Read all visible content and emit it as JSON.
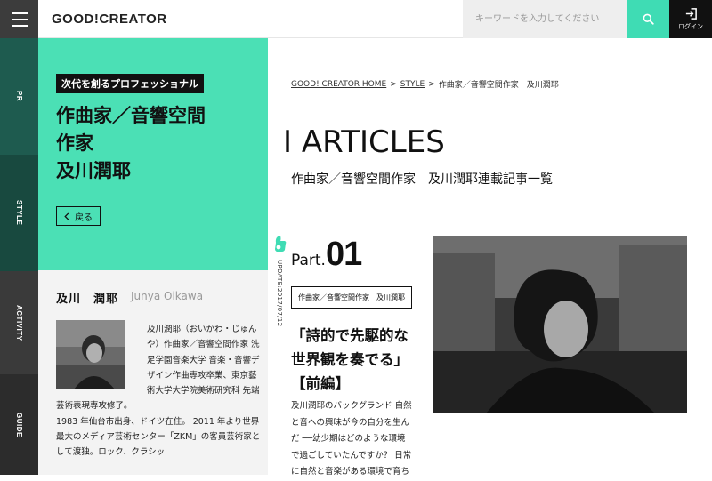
{
  "header": {
    "logo": "GOOD!CREATOR",
    "search_placeholder": "キーワードを入力してください",
    "login_label": "ログイン"
  },
  "sidenav": {
    "items": [
      {
        "label": "PR"
      },
      {
        "label": "STYLE"
      },
      {
        "label": "ACTIVITY"
      },
      {
        "label": "GUIDE"
      }
    ]
  },
  "panel": {
    "tag": "次代を創るプロフェッショナル",
    "headline_lines": [
      "作曲家／音響空間",
      "作家",
      "及川潤耶"
    ],
    "back_label": "戻る"
  },
  "profile": {
    "name": "及川　潤耶",
    "roman": "Junya Oikawa",
    "bio_1": "及川潤耶（おいかわ・じゅんや）作曲家／音響空間作家 洗足学園音楽大学 音楽・音響デザイン作曲専攻卒業、東京藝術大学大学院美術研究科 先端芸術表現専攻修了。",
    "bio_2": "1983 年仙台市出身、ドイツ在住。 2011 年より世界最大のメディア芸術センター「ZKM」の客員芸術家として渡独。ロック、クラシッ"
  },
  "breadcrumb": {
    "items": [
      "GOOD! CREATOR HOME",
      "STYLE",
      "作曲家／音響空間作家　及川潤耶"
    ],
    "separator": ">"
  },
  "main": {
    "title": "I ARTICLES",
    "subtitle": "作曲家／音響空間作家　及川潤耶連載記事一覧"
  },
  "article": {
    "update": "UPDATE:2017/07/12",
    "part_label": "Part.",
    "part_number": "01",
    "category": "作曲家／音響空間作家　及川潤耶",
    "title": "「詩的で先駆的な世界観を奏でる」【前編】",
    "body": "及川潤耶のバックグランド 自然と音への興味が今の自分を生んだ ──幼少期はどのような環境で過ごしていたんですか？ 日常に自然と音楽がある環境で育ち"
  },
  "colors": {
    "accent": "#4be0b5",
    "search_button": "#3fdcb4",
    "nav_pr": "#1e5b4f",
    "nav_style": "#18493f",
    "nav_activity": "#3a3a3a",
    "nav_guide": "#2c2c2c"
  },
  "icons": {
    "search": "search-icon",
    "login": "login-icon",
    "menu": "hamburger-icon",
    "back": "chevron-left-icon",
    "thumb": "thumbs-up-icon"
  }
}
